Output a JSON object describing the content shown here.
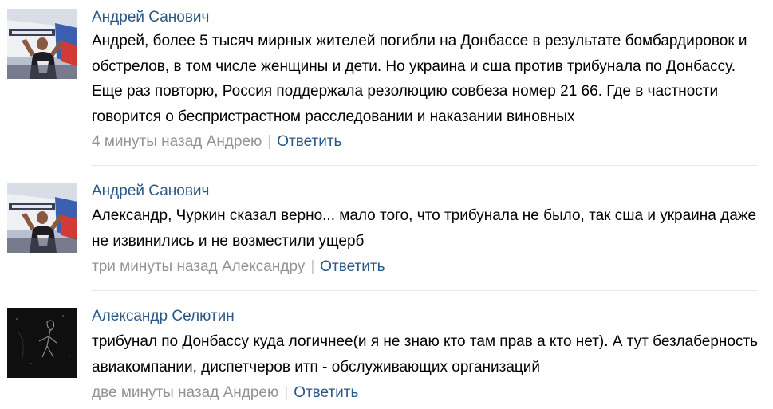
{
  "comments": [
    {
      "author": "Андрей Санович",
      "avatar_icon": "marussia-flag-avatar-icon",
      "text": "Андрей, более 5 тысяч мирных жителей погибли на Донбассе в результате бомбардировок и обстрелов, в том числе женщины и дети. Но украина и сша против трибунала по Донбассу. Еще раз повторю, Россия поддержала резолюцию совбеза номер 21 66. Где в частности говорится о беспристрастном расследовании и наказании виновных",
      "time": "4 минуты назад Андрею",
      "separator": "|",
      "reply_label": "Ответить"
    },
    {
      "author": "Андрей Санович",
      "avatar_icon": "marussia-flag-avatar-icon",
      "text": "Александр, Чуркин сказал верно... мало того, что трибунала не было, так сша и украина даже не извинились и не возместили ущерб",
      "time": "три минуты назад Александру",
      "separator": "|",
      "reply_label": "Ответить"
    },
    {
      "author": "Александр Селютин",
      "avatar_icon": "dark-silhouette-avatar-icon",
      "text": "трибунал по Донбассу куда логичнее(и я не знаю кто там прав а кто нет). А тут безлаберность авиакомпании, диспетчеров итп - обслуживающих организаций",
      "time": "две минуты назад Андрею",
      "separator": "|",
      "reply_label": "Ответить"
    }
  ],
  "colors": {
    "link": "#2a5885",
    "meta": "#939393",
    "text": "#000000",
    "divider": "#e7e8ec"
  }
}
